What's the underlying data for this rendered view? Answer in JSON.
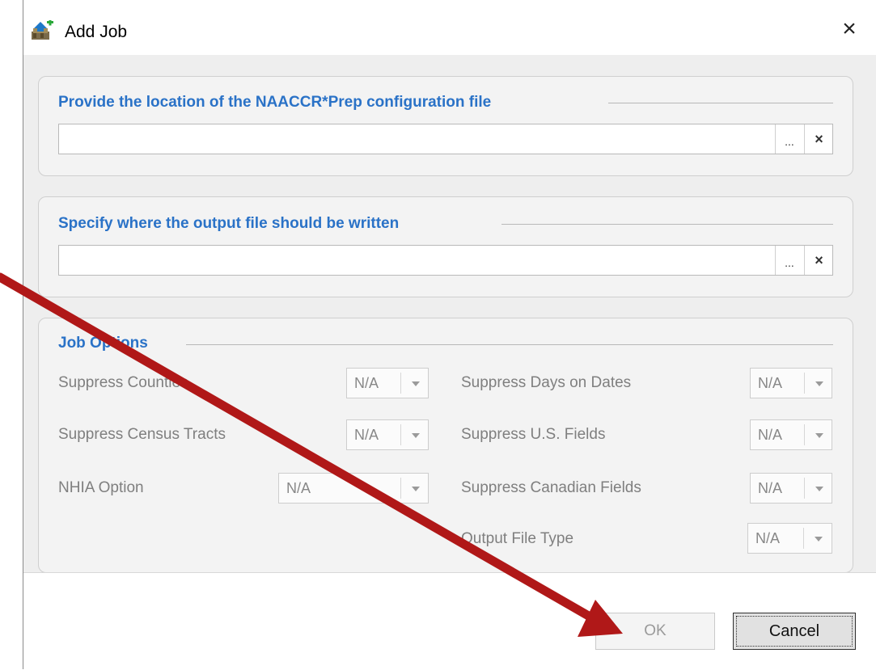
{
  "window": {
    "title": "Add Job",
    "close_label": "×",
    "icon": "add-job-icon"
  },
  "config_section": {
    "title": "Provide the location of the NAACCR*Prep configuration file",
    "value": "",
    "browse_label": "...",
    "clear_label": "×"
  },
  "output_section": {
    "title": "Specify where the output file should be written",
    "value": "",
    "browse_label": "...",
    "clear_label": "×"
  },
  "job_options": {
    "title": "Job Options",
    "suppress_counties": {
      "label": "Suppress Counties",
      "value": "N/A"
    },
    "suppress_census_tracts": {
      "label": "Suppress Census Tracts",
      "value": "N/A"
    },
    "nhia_option": {
      "label": "NHIA Option",
      "value": "N/A"
    },
    "suppress_days_on_dates": {
      "label": "Suppress Days on Dates",
      "value": "N/A"
    },
    "suppress_us_fields": {
      "label": "Suppress U.S. Fields",
      "value": "N/A"
    },
    "suppress_canadian_fields": {
      "label": "Suppress Canadian Fields",
      "value": "N/A"
    },
    "output_file_type": {
      "label": "Output File Type",
      "value": "N/A"
    }
  },
  "buttons": {
    "ok_label": "OK",
    "cancel_label": "Cancel"
  },
  "colors": {
    "section_title": "#2a72c7",
    "annotation_arrow": "#b01818"
  }
}
